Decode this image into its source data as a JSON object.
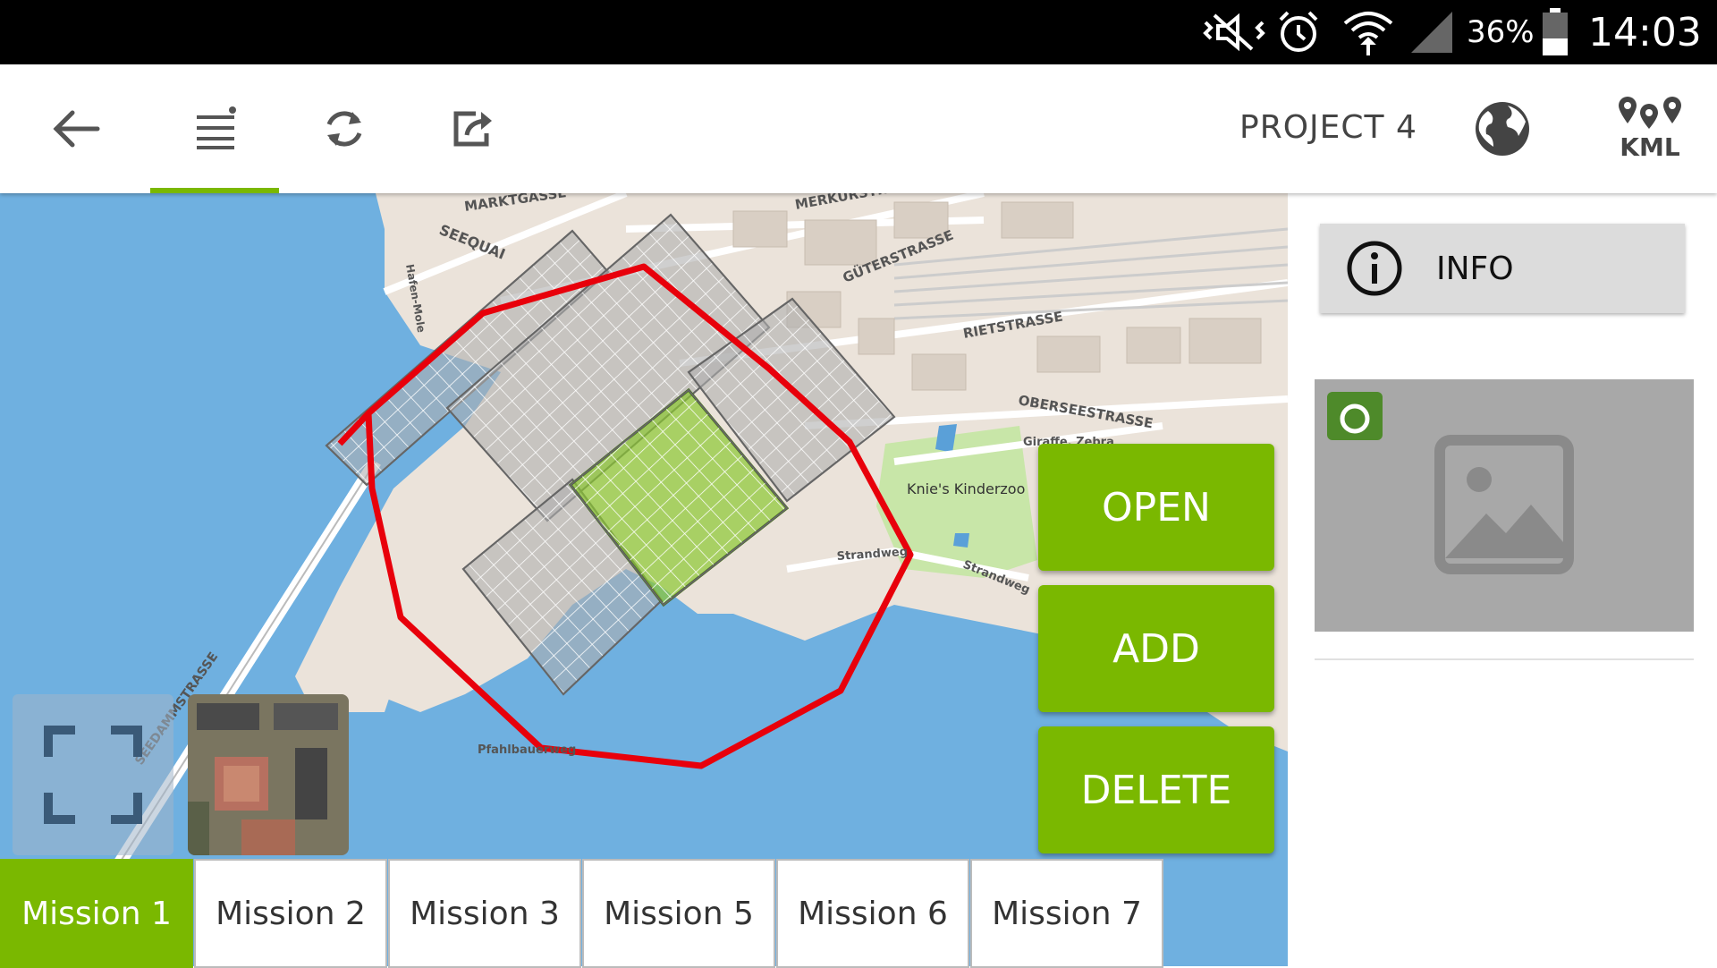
{
  "status_bar": {
    "icons": [
      "mute-vibrate-icon",
      "alarm-icon",
      "wifi-icon",
      "signal-icon"
    ],
    "battery": "36%",
    "time": "14:03"
  },
  "toolbar": {
    "icons": [
      "back-arrow-icon",
      "list-icon",
      "sync-icon",
      "share-icon"
    ],
    "project_title": "PROJECT 4",
    "kml_label": "KML"
  },
  "map": {
    "streets": {
      "marktgasse": "MARKTGASSE",
      "merkurstrasse": "MERKURSTR",
      "seequai": "SEEQUAI",
      "hafenmole": "Hafen-Mole",
      "gueterstrasse": "GÜTERSTRASSE",
      "rietstrasse": "RIETSTRASSE",
      "oberseestrasse": "OBERSEESTRASSE",
      "seedammstrasse": "SEEDAMMSTRASSE",
      "strandweg": "Strandweg",
      "strandweg2": "Strandweg",
      "pfahlbauer": "Pfahlbauerweg",
      "giraffe": "Giraffe, Zebra",
      "kinderzoo": "Knie's Kinderzoo"
    }
  },
  "actions": {
    "open": "OPEN",
    "add": "ADD",
    "delete": "DELETE"
  },
  "sidebar": {
    "info_label": "INFO"
  },
  "missions": [
    {
      "label": "Mission 1",
      "active": true
    },
    {
      "label": "Mission 2",
      "active": false
    },
    {
      "label": "Mission 3",
      "active": false
    },
    {
      "label": "Mission 5",
      "active": false
    },
    {
      "label": "Mission 6",
      "active": false
    },
    {
      "label": "Mission 7",
      "active": false
    }
  ],
  "colors": {
    "accent": "#7ab800",
    "water": "#6fb0e0",
    "land": "#ebe3da",
    "flight_path": "#e8000b"
  }
}
